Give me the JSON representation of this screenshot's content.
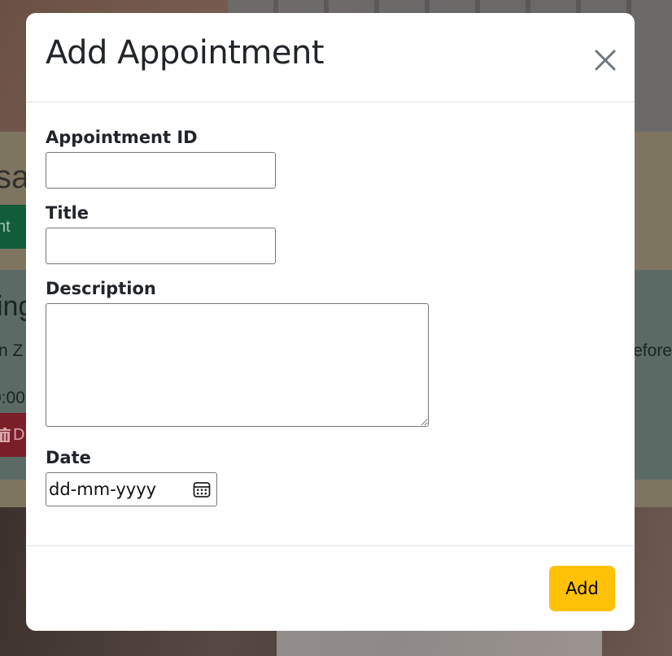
{
  "background": {
    "heading_fragment": "sa",
    "green_button_fragment": "nt",
    "card_title_fragment": "ing",
    "card_text_left_fragment": "n Z",
    "card_text_right_fragment": "efore",
    "card_time_fragment": "0:00",
    "red_button_fragment": "D"
  },
  "modal": {
    "title": "Add Appointment",
    "close_icon": "close-x-icon",
    "fields": {
      "appointment_id": {
        "label": "Appointment ID",
        "value": ""
      },
      "title": {
        "label": "Title",
        "value": ""
      },
      "description": {
        "label": "Description",
        "value": ""
      },
      "date": {
        "label": "Date",
        "display": "dd-mm-yyyy",
        "icon": "calendar-icon"
      }
    },
    "add_button_label": "Add"
  },
  "colors": {
    "accent_add": "#ffc107",
    "text": "#212529",
    "divider": "#dee2e6"
  }
}
